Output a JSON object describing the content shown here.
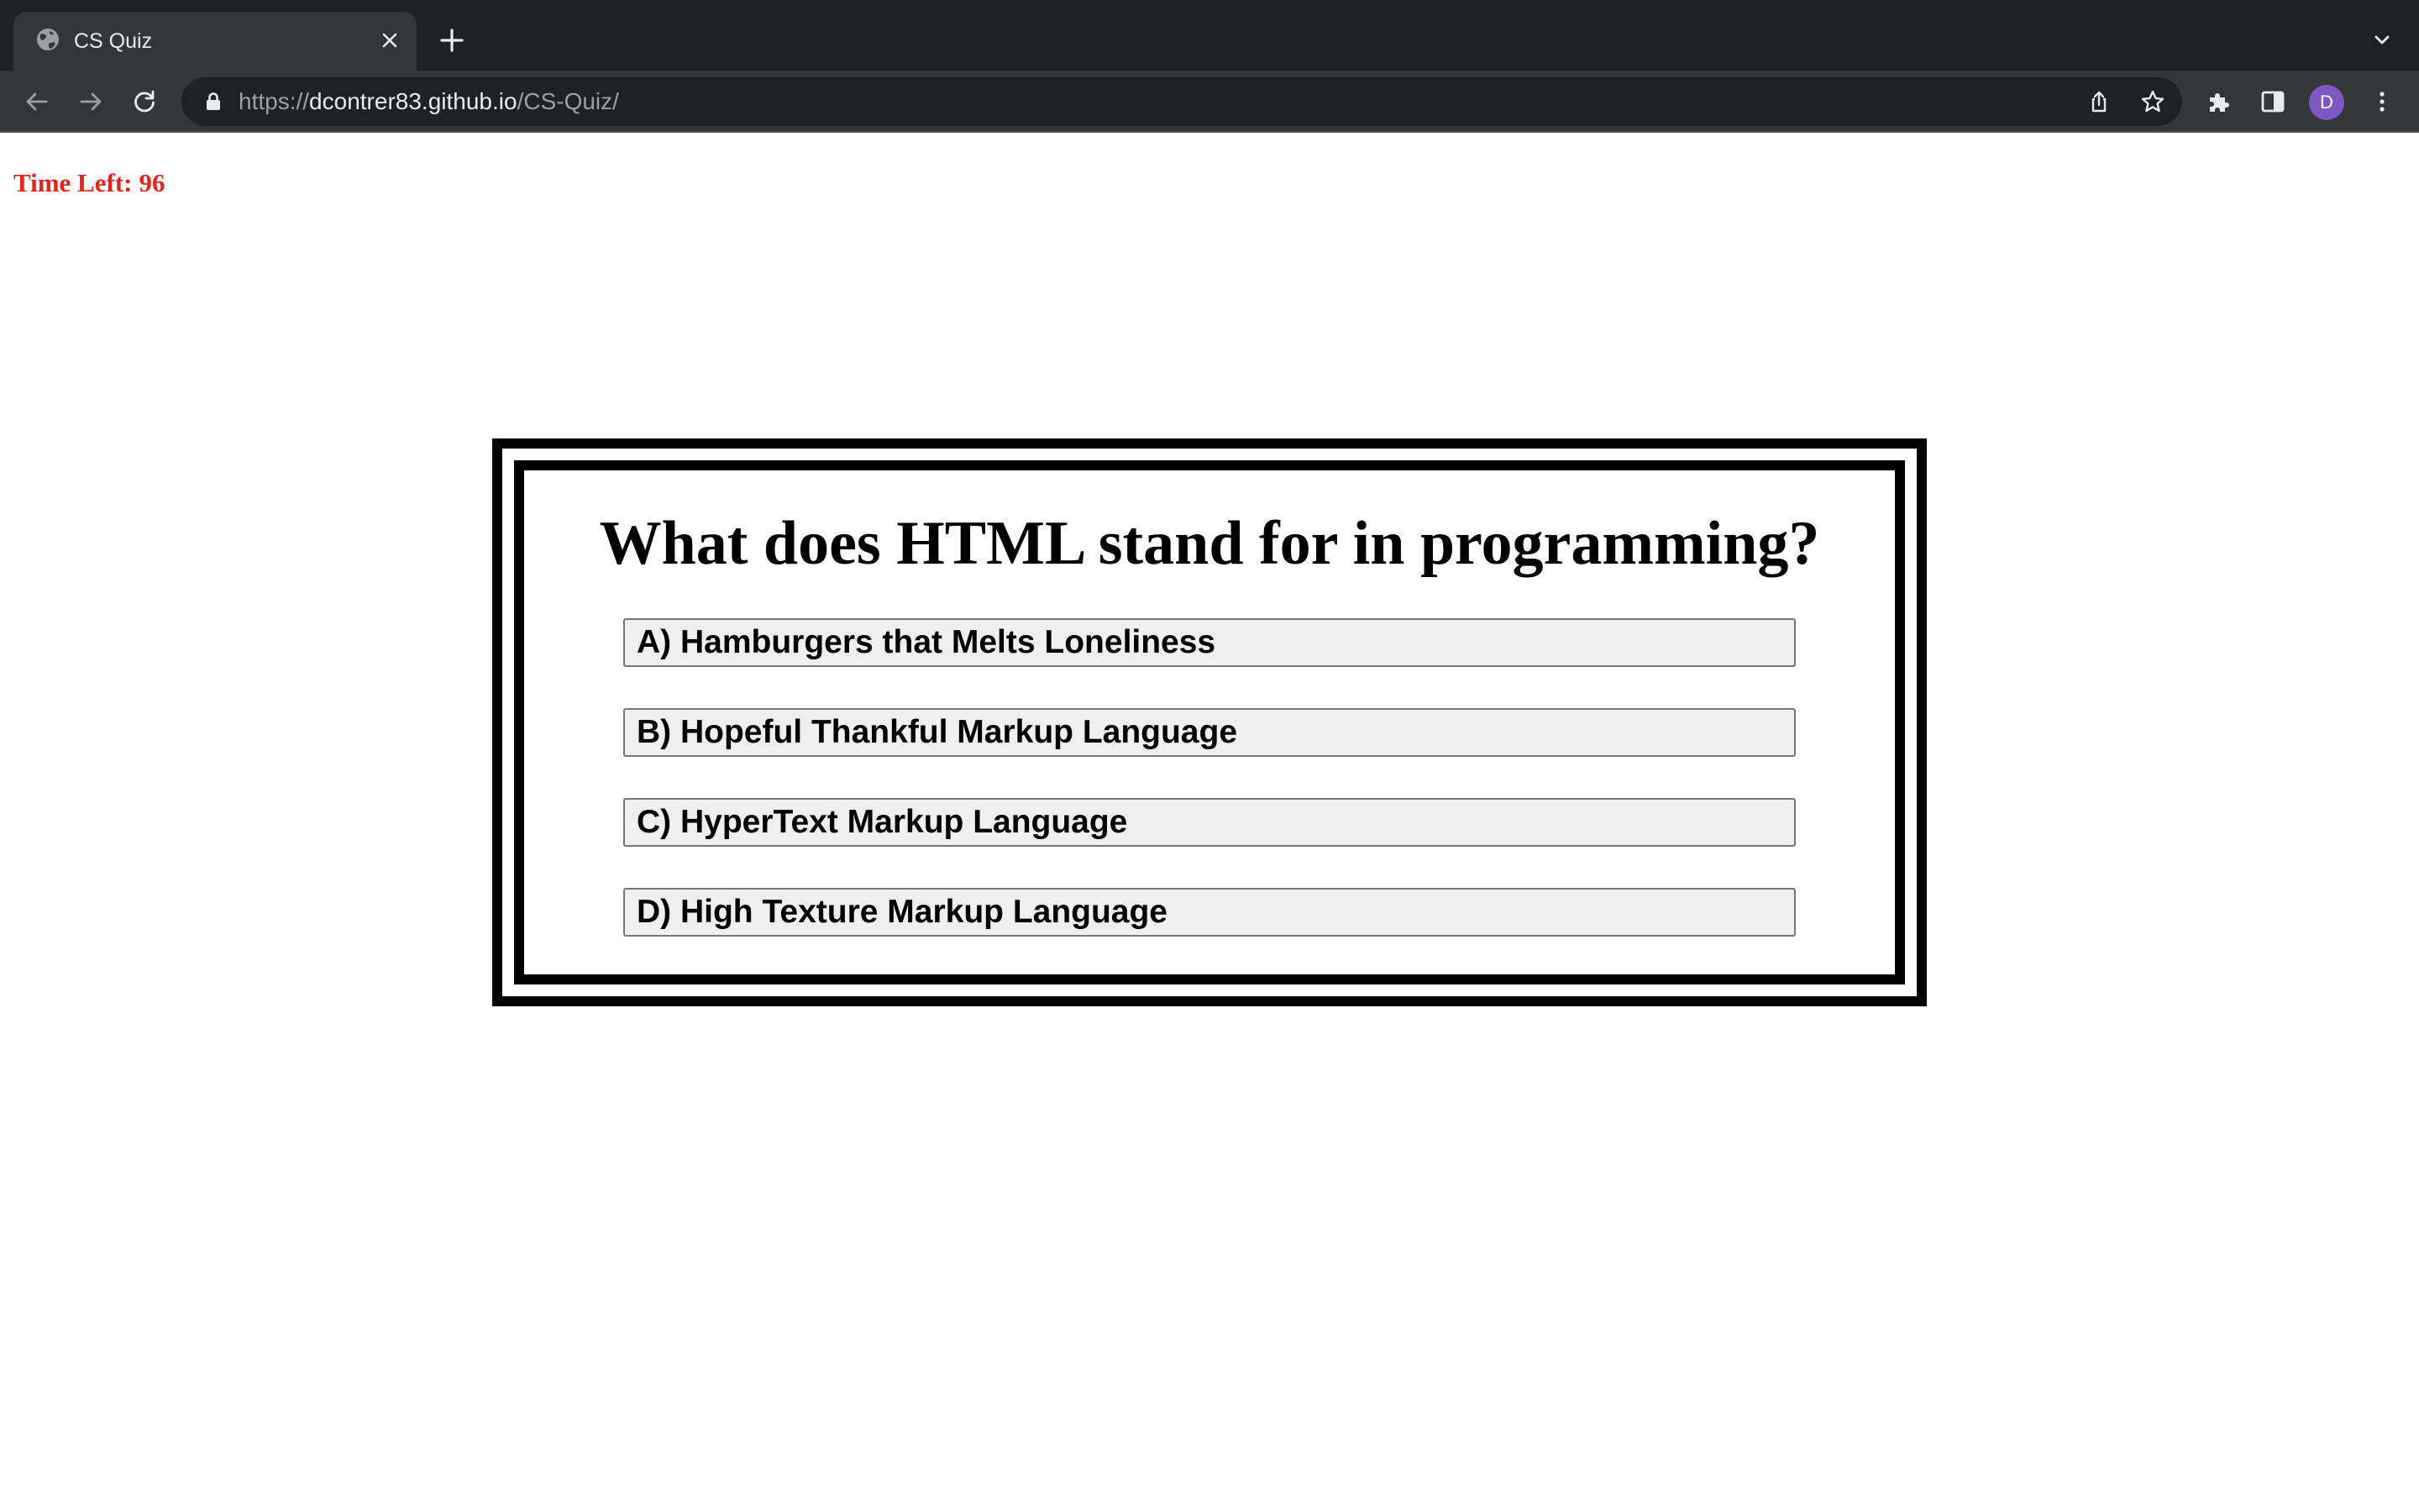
{
  "browser": {
    "tab_title": "CS Quiz",
    "url_scheme": "https://",
    "url_host": "dcontrer83.github.io",
    "url_path": "/CS-Quiz/",
    "profile_initial": "D",
    "profile_color": "#7e57c2",
    "icons": [
      "globe-icon",
      "close-icon",
      "plus-icon",
      "chevron-down-icon",
      "back-arrow-icon",
      "forward-arrow-icon",
      "reload-icon",
      "lock-icon",
      "share-icon",
      "star-icon",
      "puzzle-icon",
      "side-panel-icon",
      "more-vert-icon"
    ]
  },
  "timer": {
    "label": "Time Left:",
    "value": "96",
    "color": "#e5251b"
  },
  "quiz": {
    "question": "What does HTML stand for in programming?",
    "answers": [
      "A) Hamburgers that Melts Loneliness",
      "B) Hopeful Thankful Markup Language",
      "C) HyperText Markup Language",
      "D) High Texture Markup Language"
    ]
  }
}
